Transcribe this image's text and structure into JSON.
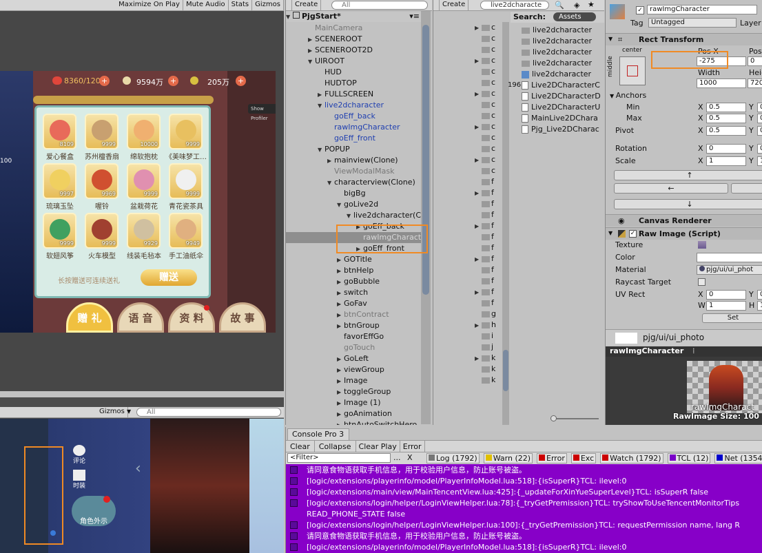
{
  "game_toolbar": {
    "maximize": "Maximize On Play",
    "mute": "Mute Audio",
    "stats": "Stats",
    "gizmos": "Gizmos"
  },
  "game": {
    "currency1": "8360/120",
    "currency2": "9594万",
    "currency3": "205万",
    "show_profiler": "Show Profiler",
    "edge_value": "100",
    "hint": "长按赠送可连续送礼",
    "give_btn": "赠送",
    "items": [
      {
        "name": "爱心餐盒",
        "count": "8109"
      },
      {
        "name": "苏州檀香扇",
        "count": "9999"
      },
      {
        "name": "绵软抱枕",
        "count": "10000"
      },
      {
        "name": "《美味梦工…",
        "count": "9999"
      },
      {
        "name": "琉璃玉坠",
        "count": "9997"
      },
      {
        "name": "喔铃",
        "count": "9969"
      },
      {
        "name": "盆栽荷花",
        "count": "9999"
      },
      {
        "name": "青花瓷茶具",
        "count": "9999"
      },
      {
        "name": "软翅风筝",
        "count": "9999"
      },
      {
        "name": "火车模型",
        "count": "9999"
      },
      {
        "name": "线装毛毡本",
        "count": "9929"
      },
      {
        "name": "手工油纸伞",
        "count": "9949"
      }
    ],
    "tabs": [
      "赠 礼",
      "语 音",
      "资 料",
      "故 事"
    ]
  },
  "scene_toolbar": {
    "gizmos": "Gizmos",
    "search": "All"
  },
  "scene": {
    "icon1": "评论",
    "icon2": "时装",
    "badge": "角色外示"
  },
  "hierarchy": {
    "create": "Create",
    "search": "All",
    "root": "PjgStart*",
    "rows": [
      {
        "t": "MainCamera",
        "d": 1,
        "a": "",
        "s": "dis"
      },
      {
        "t": "SCENEROOT",
        "d": 1,
        "a": "▶",
        "s": ""
      },
      {
        "t": "SCENEROOT2D",
        "d": 1,
        "a": "▶",
        "s": ""
      },
      {
        "t": "UIROOT",
        "d": 1,
        "a": "▼",
        "s": ""
      },
      {
        "t": "HUD",
        "d": 2,
        "a": "",
        "s": ""
      },
      {
        "t": "HUDTOP",
        "d": 2,
        "a": "",
        "s": ""
      },
      {
        "t": "FULLSCREEN",
        "d": 2,
        "a": "▶",
        "s": ""
      },
      {
        "t": "live2dcharacter",
        "d": 2,
        "a": "▼",
        "s": "blue"
      },
      {
        "t": "goEff_back",
        "d": 3,
        "a": "",
        "s": "blue"
      },
      {
        "t": "rawImgCharacter",
        "d": 3,
        "a": "",
        "s": "blue"
      },
      {
        "t": "goEff_front",
        "d": 3,
        "a": "",
        "s": "blue"
      },
      {
        "t": "POPUP",
        "d": 2,
        "a": "▼",
        "s": ""
      },
      {
        "t": "mainview(Clone)",
        "d": 3,
        "a": "▶",
        "s": ""
      },
      {
        "t": "ViewModalMask",
        "d": 3,
        "a": "",
        "s": "dis"
      },
      {
        "t": "characterview(Clone)",
        "d": 3,
        "a": "▼",
        "s": ""
      },
      {
        "t": "bigBg",
        "d": 4,
        "a": "",
        "s": ""
      },
      {
        "t": "goLive2d",
        "d": 4,
        "a": "▼",
        "s": ""
      },
      {
        "t": "live2dcharacter(Clo",
        "d": 5,
        "a": "▼",
        "s": ""
      },
      {
        "t": "goEff_back",
        "d": 6,
        "a": "▶",
        "s": ""
      },
      {
        "t": "rawImgCharacte",
        "d": 6,
        "a": "",
        "s": "sel"
      },
      {
        "t": "goEff_front",
        "d": 6,
        "a": "▶",
        "s": ""
      },
      {
        "t": "GOTitle",
        "d": 4,
        "a": "▶",
        "s": ""
      },
      {
        "t": "btnHelp",
        "d": 4,
        "a": "▶",
        "s": ""
      },
      {
        "t": "goBubble",
        "d": 4,
        "a": "▶",
        "s": ""
      },
      {
        "t": "switch",
        "d": 4,
        "a": "▶",
        "s": ""
      },
      {
        "t": "GoFav",
        "d": 4,
        "a": "▶",
        "s": ""
      },
      {
        "t": "btnContract",
        "d": 4,
        "a": "▶",
        "s": "dis"
      },
      {
        "t": "btnGroup",
        "d": 4,
        "a": "▶",
        "s": ""
      },
      {
        "t": "favorEffGo",
        "d": 4,
        "a": "",
        "s": ""
      },
      {
        "t": "goTouch",
        "d": 4,
        "a": "",
        "s": "dis"
      },
      {
        "t": "GoLeft",
        "d": 4,
        "a": "▶",
        "s": ""
      },
      {
        "t": "viewGroup",
        "d": 4,
        "a": "▶",
        "s": ""
      },
      {
        "t": "Image",
        "d": 4,
        "a": "▶",
        "s": ""
      },
      {
        "t": "toggleGroup",
        "d": 4,
        "a": "▶",
        "s": ""
      },
      {
        "t": "Image (1)",
        "d": 4,
        "a": "▶",
        "s": ""
      },
      {
        "t": "goAnimation",
        "d": 4,
        "a": "▶",
        "s": ""
      },
      {
        "t": "btnAutoSwitchHero",
        "d": 4,
        "a": "▶",
        "s": ""
      }
    ]
  },
  "project": {
    "create": "Create",
    "search": "live2dcharacte",
    "search_label": "Search:",
    "assets": "Assets",
    "side_num": "196",
    "folder_letters": [
      "c",
      "c",
      "c",
      "c",
      "c",
      "c",
      "c",
      "c",
      "c",
      "c",
      "c",
      "c",
      "c",
      "c",
      "f",
      "f",
      "f",
      "f",
      "f",
      "f",
      "f",
      "f",
      "f",
      "f",
      "f",
      "f",
      "g",
      "h",
      "i",
      "j",
      "k",
      "k",
      "k"
    ],
    "results": [
      "live2dcharacter",
      "live2dcharacter",
      "live2dcharacter",
      "live2dcharacter",
      "live2dcharacter",
      "Live2DCharacterC",
      "Live2DCharacterD",
      "Live2DCharacterU",
      "MainLive2DChara",
      "Pjg_Live2DCharac"
    ]
  },
  "inspector": {
    "name": "rawImgCharacter",
    "tag_label": "Tag",
    "tag": "Untagged",
    "layer_label": "Layer",
    "rect_title": "Rect Transform",
    "center": "center",
    "middle": "middle",
    "posx_label": "Pos X",
    "posx": "-275",
    "posy_label": "Pos Y",
    "posy": "0",
    "width_label": "Width",
    "width": "1000",
    "height_label": "Heig",
    "height": "720",
    "anchors": "Anchors",
    "min": "Min",
    "max": "Max",
    "pivot": "Pivot",
    "rotation": "Rotation",
    "scale": "Scale",
    "v05": "0.5",
    "v0": "0",
    "v1": "1",
    "x": "X",
    "y": "Y",
    "w": "W",
    "h": "H",
    "up": "↑",
    "left": "←",
    "down": "↓",
    "canvas_renderer": "Canvas Renderer",
    "raw_image": "Raw Image (Script)",
    "texture": "Texture",
    "color": "Color",
    "material": "Material",
    "material_val": "pjg/ui/ui_phot",
    "raycast": "Raycast Target",
    "uvrect": "UV Rect",
    "set": "Set",
    "material_preview": "pjg/ui/ui_photo",
    "preview_title": "rawImgCharacter",
    "preview_name": "rawImgCharact",
    "preview_size": "RawImage Size: 100"
  },
  "console": {
    "tab": "Console Pro 3",
    "clear": "Clear",
    "collapse": "Collapse",
    "clear_play": "Clear Play",
    "error": "Error",
    "filter": "<Filter>",
    "dots": "...",
    "x": "X",
    "counts": [
      {
        "label": "Log (1792)",
        "color": "#777777"
      },
      {
        "label": "Warn (22)",
        "color": "#e0c000"
      },
      {
        "label": "Error",
        "color": "#cc0000"
      },
      {
        "label": "Exc",
        "color": "#cc0000"
      },
      {
        "label": "Watch (1792)",
        "color": "#cc0000"
      },
      {
        "label": "TCL (12)",
        "color": "#7a00c8"
      },
      {
        "label": "Net (1354)",
        "color": "#0000cc"
      }
    ],
    "lines": [
      "请同意食物语获取手机信息，用于校验用户信息，防止账号被盗。",
      "[logic/extensions/playerinfo/model/PlayerInfoModel.lua:518]:{isSuperR}TCL: ilevel:0",
      "[logic/extensions/main/view/MainTencentView.lua:425]:{_updateForXinYueSuperLevel}TCL: isSuperR false",
      "[logic/extensions/login/helper/LoginViewHelper.lua:78]:{_tryGetPremission}TCL: tryShowToUseTencentMonitorTips",
      "READ_PHONE_STATE false",
      "[logic/extensions/login/helper/LoginViewHelper.lua:100]:{_tryGetPremission}TCL: requestPermission name, lang R",
      "请同意食物语获取手机信息，用于校验用户信息，防止账号被盗。",
      "[logic/extensions/playerinfo/model/PlayerInfoModel.lua:518]:{isSuperR}TCL: ilevel:0"
    ]
  }
}
